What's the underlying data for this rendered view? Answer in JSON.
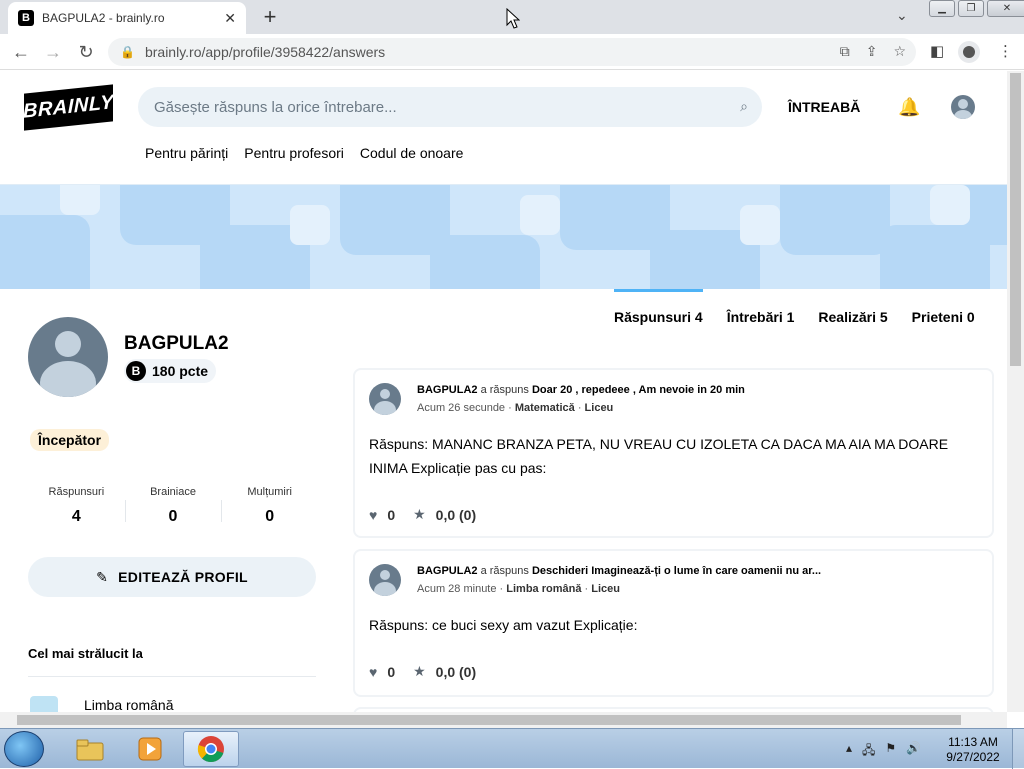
{
  "browser": {
    "tab_title": "BAGPULA2 - brainly.ro",
    "tab_favicon": "B",
    "url": "brainly.ro/app/profile/3958422/answers"
  },
  "header": {
    "logo": "BRAINLY",
    "search_placeholder": "Găsește răspuns la orice întrebare...",
    "ask_label": "ÎNTREABĂ",
    "subnav": [
      "Pentru părinți",
      "Pentru profesori",
      "Codul de onoare"
    ]
  },
  "profile": {
    "username": "BAGPULA2",
    "points": "180 pcte",
    "rank": "Începător",
    "stats": [
      {
        "label": "Răspunsuri",
        "value": "4"
      },
      {
        "label": "Brainiace",
        "value": "0"
      },
      {
        "label": "Mulțumiri",
        "value": "0"
      }
    ],
    "edit_label": "EDITEAZĂ PROFIL",
    "brightest_title": "Cel mai strălucit la",
    "subject": "Limba română"
  },
  "tabs": [
    {
      "label": "Răspunsuri 4",
      "active": true
    },
    {
      "label": "Întrebări 1",
      "active": false
    },
    {
      "label": "Realizări 5",
      "active": false
    },
    {
      "label": "Prieteni 0",
      "active": false
    }
  ],
  "answers": [
    {
      "user": "BAGPULA2",
      "verb": "a răspuns",
      "question": "Doar 20 , repedeee , Am nevoie in 20 min",
      "time": "Acum 26 secunde",
      "subject": "Matematică",
      "level": "Liceu",
      "text": "Răspuns: MANANC BRANZA PETA, NU VREAU CU IZOLETA CA DACA MA AIA MA DOARE INIMA Explicație pas cu pas:",
      "likes": "0",
      "rating": "0,0 (0)"
    },
    {
      "user": "BAGPULA2",
      "verb": "a răspuns",
      "question": "Deschideri Imaginează-ți o lume în care oamenii nu ar...",
      "time": "Acum 28 minute",
      "subject": "Limba română",
      "level": "Liceu",
      "text": "Răspuns: ce buci sexy am vazut Explicație:",
      "likes": "0",
      "rating": "0,0 (0)"
    }
  ],
  "taskbar": {
    "time": "11:13 AM",
    "date": "9/27/2022"
  },
  "colors": {
    "accent": "#4fb3f6",
    "banner": "#cfe6fa",
    "search_bg": "#ebf2f7",
    "rank_bg": "#fdf0d8"
  }
}
